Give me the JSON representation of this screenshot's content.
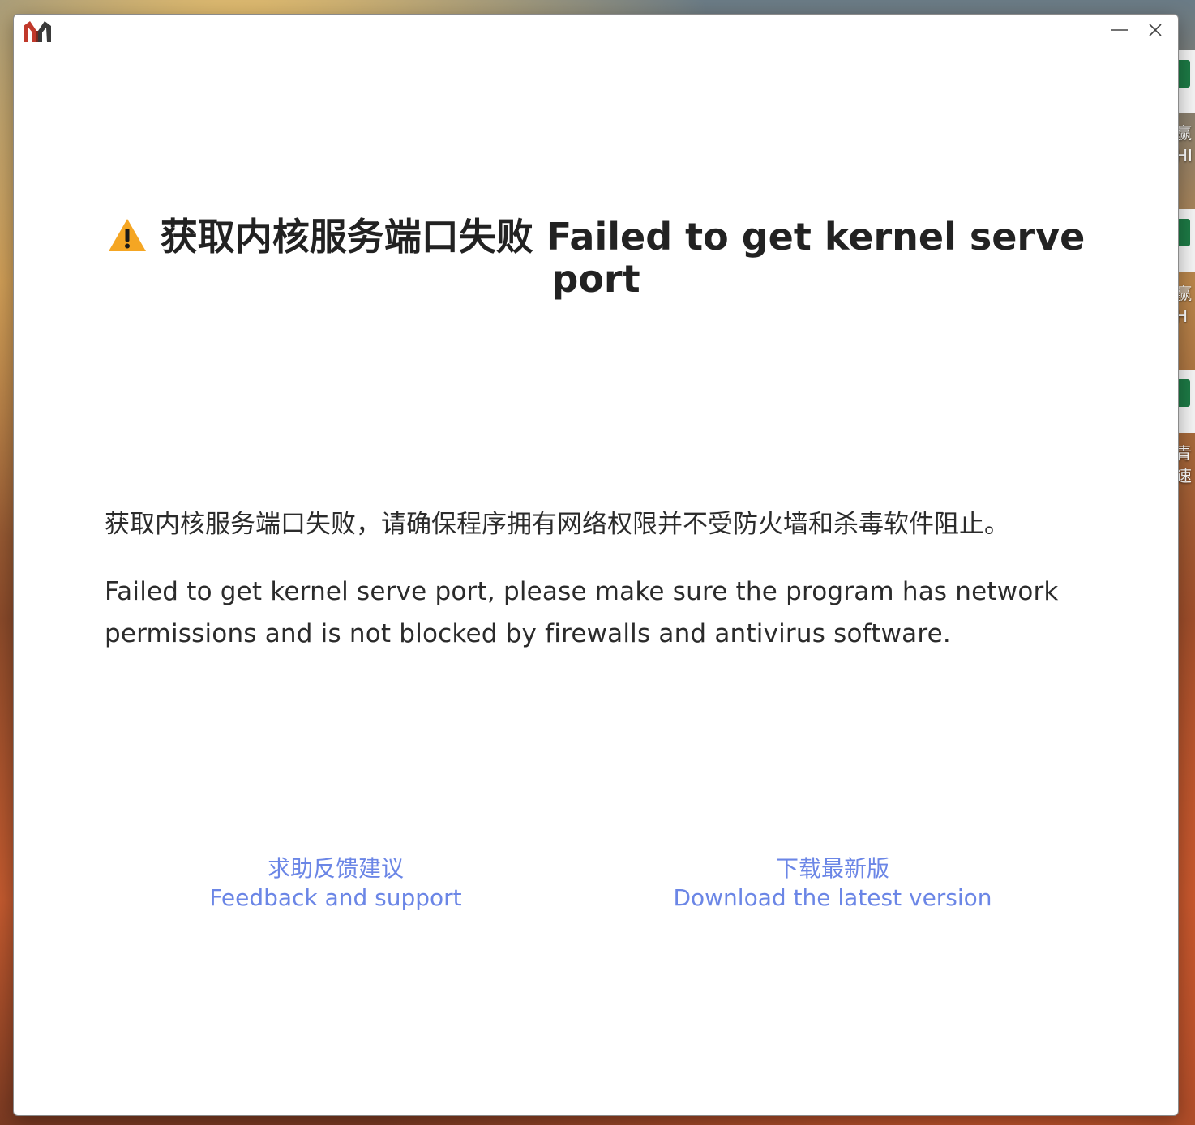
{
  "window": {
    "logo_icon": "app-logo-icon",
    "controls": {
      "minimize_icon": "minimize-icon",
      "close_icon": "close-icon"
    }
  },
  "error": {
    "warning_icon": "warning-triangle-icon",
    "title": "获取内核服务端口失败 Failed to get kernel serve port",
    "message_cn": "获取内核服务端口失败，请确保程序拥有网络权限并不受防火墙和杀毒软件阻止。",
    "message_en": "Failed to get kernel serve port, please make sure the program has network permissions and is not blocked by firewalls and antivirus software."
  },
  "links": {
    "feedback": {
      "label_cn": "求助反馈建议",
      "label_en": "Feedback and support"
    },
    "download": {
      "label_cn": "下载最新版",
      "label_en": "Download the latest version"
    }
  },
  "desktop": {
    "icon_labels": [
      "赢HI",
      "赢H",
      "青速"
    ]
  },
  "colors": {
    "link": "#6b86e6",
    "warning": "#f5a623",
    "text": "#222222",
    "logo_red": "#c0392b",
    "logo_dark": "#3a3a3a"
  }
}
